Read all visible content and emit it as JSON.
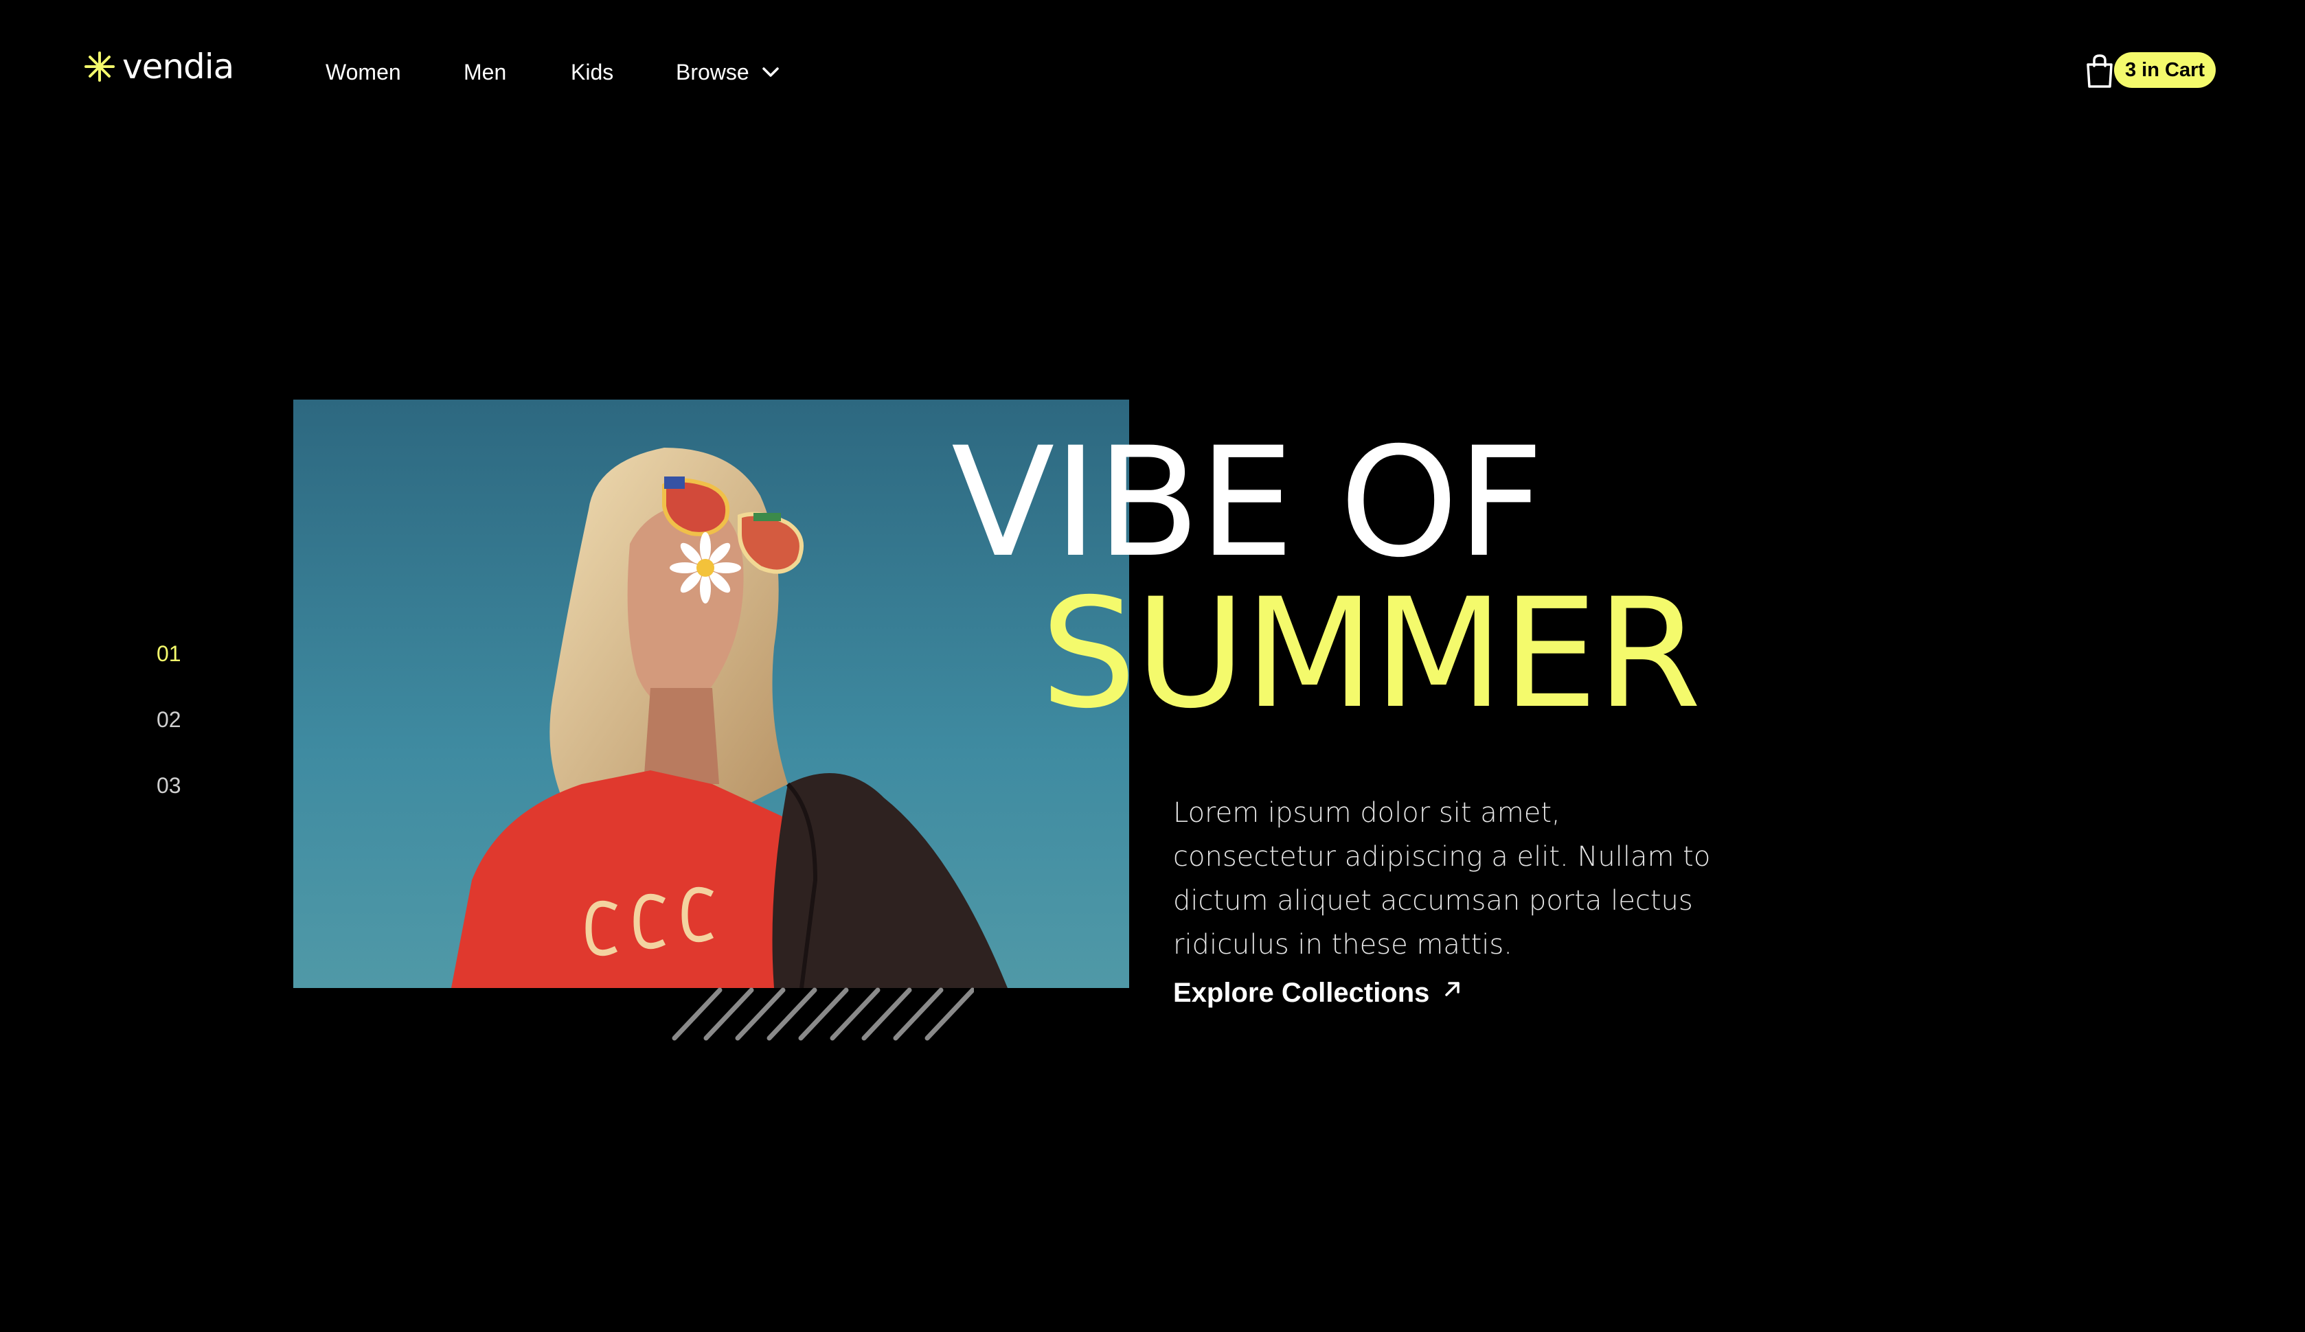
{
  "brand": {
    "name": "vendia",
    "accent_color": "#f4fa6c",
    "logo_icon": "asterisk-burst-icon"
  },
  "nav": {
    "items": [
      {
        "label": "Women"
      },
      {
        "label": "Men"
      },
      {
        "label": "Kids"
      },
      {
        "label": "Browse",
        "icon": "chevron-down-icon"
      }
    ]
  },
  "cart": {
    "icon": "shopping-bag-icon",
    "badge": "3 in Cart"
  },
  "slides": {
    "items": [
      "01",
      "02",
      "03"
    ],
    "active_index": 0
  },
  "hero": {
    "headline_line1": "VIBE OF",
    "headline_line2": "SUMMER",
    "body": "Lorem ipsum dolor sit amet, consectetur adipiscing a elit. Nullam to dictum aliquet accumsan porta lectus ridiculus in these mattis.",
    "cta_label": "Explore Collections",
    "cta_icon": "arrow-up-right-icon",
    "image_subject": "woman-with-sunglasses-and-daisy-photo"
  }
}
